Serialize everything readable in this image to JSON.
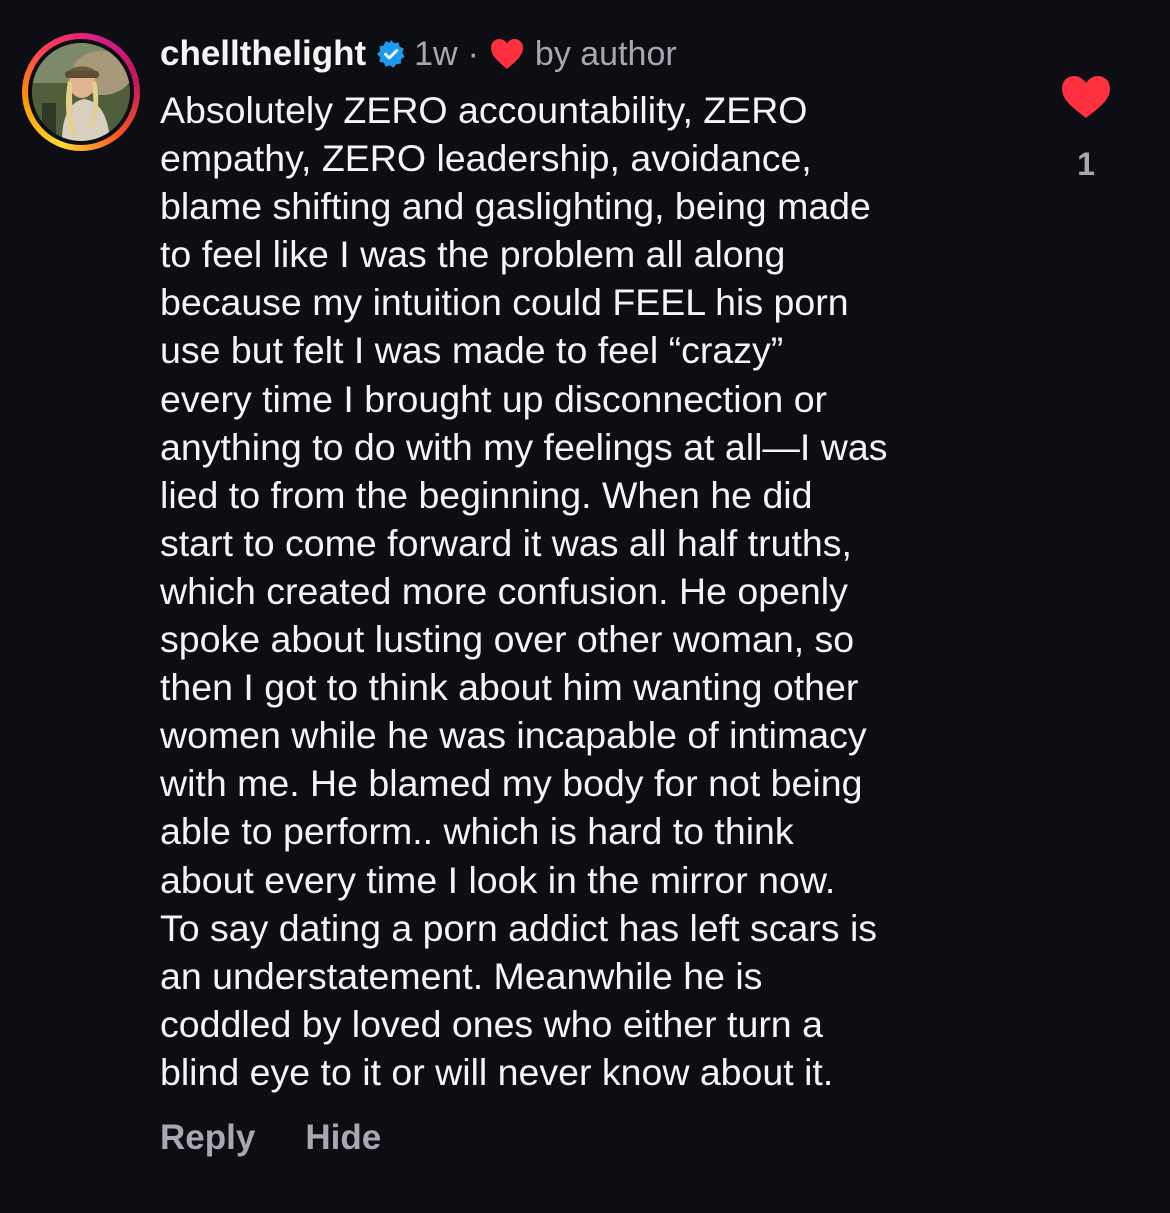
{
  "comment": {
    "username": "chellthelight",
    "verified_icon": "verified-badge-icon",
    "time_ago": "1w",
    "separator": "·",
    "author_like_label": "by author",
    "body_lines": [
      "Absolutely ZERO accountability, ZERO",
      "empathy, ZERO leadership, avoidance,",
      "blame shifting and gaslighting, being made",
      "to feel like I was the problem all along",
      "because my intuition could FEEL his porn",
      "use but felt I was made to feel “crazy”",
      "every time I brought up disconnection or",
      "anything to do with my feelings at all—I was",
      "lied to from the beginning. When he did",
      "start to come forward it was all half truths,",
      "which created more confusion. He openly",
      "spoke about lusting over other woman, so",
      "then I got to think about him wanting other",
      "women while he was incapable of intimacy",
      "with me. He blamed my body for not being",
      "able to perform.. which is hard to think",
      "about every time I look in the mirror now.",
      "To say dating a porn addict has left scars is",
      "an understatement. Meanwhile he is",
      "coddled by loved ones who either turn a",
      "blind eye to it or will never know about it."
    ],
    "like_count": "1",
    "actions": {
      "reply_label": "Reply",
      "hide_label": "Hide"
    }
  },
  "colors": {
    "background": "#0c0e14",
    "text": "#f5f5f5",
    "muted": "#a8a8b0",
    "heart": "#ff3040",
    "verified": "#1d9bf0"
  }
}
